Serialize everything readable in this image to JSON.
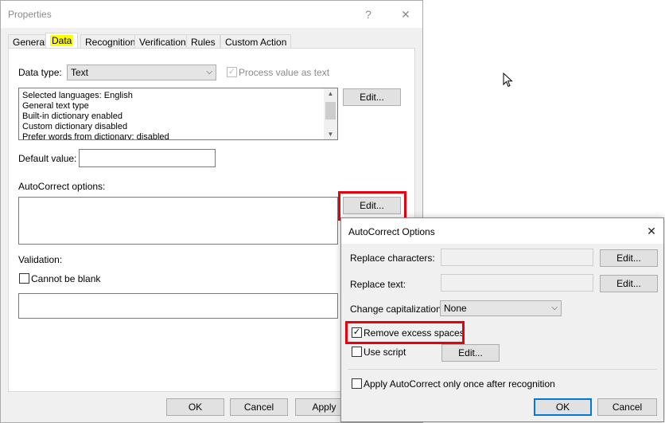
{
  "properties_dialog": {
    "title": "Properties",
    "help_label": "?",
    "close_label": "✕",
    "tabs": [
      "General",
      "Data",
      "Recognition",
      "Verification",
      "Rules",
      "Custom Action"
    ],
    "active_tab": "Data",
    "data_type_label": "Data type:",
    "data_type_value": "Text",
    "process_value_label": "Process value as text",
    "process_value_checked": true,
    "info_lines": [
      "Selected languages: English",
      "General text type",
      "Built-in dictionary enabled",
      "Custom dictionary disabled",
      "Prefer words from dictionary: disabled"
    ],
    "info_edit_label": "Edit...",
    "default_value_label": "Default value:",
    "default_value": "",
    "autocorrect_label": "AutoCorrect options:",
    "autocorrect_edit_label": "Edit...",
    "validation_label": "Validation:",
    "cannot_be_blank_label": "Cannot be blank",
    "cannot_be_blank_checked": false,
    "ok_label": "OK",
    "cancel_label": "Cancel",
    "apply_label": "Apply"
  },
  "autocorrect_dialog": {
    "title": "AutoCorrect Options",
    "close_label": "✕",
    "replace_characters_label": "Replace characters:",
    "replace_characters_edit": "Edit...",
    "replace_text_label": "Replace text:",
    "replace_text_edit": "Edit...",
    "change_capitalization_label": "Change capitalization:",
    "change_capitalization_value": "None",
    "remove_excess_spaces_label": "Remove excess spaces",
    "remove_excess_spaces_checked": true,
    "use_script_label": "Use script",
    "use_script_checked": false,
    "use_script_edit": "Edit...",
    "apply_once_label": "Apply AutoCorrect only once after recognition",
    "apply_once_checked": false,
    "ok_label": "OK",
    "cancel_label": "Cancel"
  },
  "colors": {
    "highlight_box": "#e8000b",
    "tab_highlight": "#ffff00",
    "default_button_border": "#0078d7"
  }
}
